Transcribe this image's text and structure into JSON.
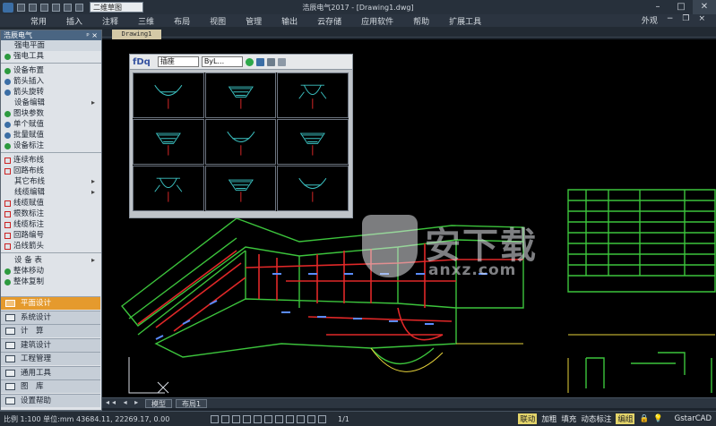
{
  "app": {
    "title": "浩辰电气2017 - [Drawing1.dwg]",
    "workspace": "二维草图"
  },
  "menu": [
    "常用",
    "插入",
    "注释",
    "三维",
    "布局",
    "视图",
    "管理",
    "输出",
    "云存储",
    "应用软件",
    "帮助",
    "扩展工具"
  ],
  "menu_right": "外观",
  "panel": {
    "title": "浩辰电气",
    "groups": [
      {
        "type": "sub",
        "label": "强电平面"
      },
      {
        "type": "item",
        "label": "强电工具",
        "icon": "dot-green"
      },
      {
        "type": "sep"
      },
      {
        "type": "item",
        "label": "设备布置",
        "icon": "dot-green"
      },
      {
        "type": "item",
        "label": "箭头插入",
        "icon": "arrow"
      },
      {
        "type": "item",
        "label": "箭头旋转",
        "icon": "arrow"
      },
      {
        "type": "item",
        "label": "设备编辑",
        "indent": true,
        "arrow": true
      },
      {
        "type": "item",
        "label": "图块参数",
        "icon": "dot-green"
      },
      {
        "type": "item",
        "label": "单个赋值",
        "icon": "arrow"
      },
      {
        "type": "item",
        "label": "批量赋值",
        "icon": "grid"
      },
      {
        "type": "item",
        "label": "设备标注",
        "icon": "dot-green"
      },
      {
        "type": "sep"
      },
      {
        "type": "item",
        "label": "连续布线",
        "icon": "line-red"
      },
      {
        "type": "item",
        "label": "回路布线",
        "icon": "line-red"
      },
      {
        "type": "item",
        "label": "其它布线",
        "indent": true,
        "arrow": true
      },
      {
        "type": "item",
        "label": "线缆编辑",
        "indent": true,
        "arrow": true
      },
      {
        "type": "item",
        "label": "线缆赋值",
        "icon": "line-red"
      },
      {
        "type": "item",
        "label": "根数标注",
        "icon": "line-red"
      },
      {
        "type": "item",
        "label": "线缆标注",
        "icon": "line-red"
      },
      {
        "type": "item",
        "label": "回路编号",
        "icon": "line-red"
      },
      {
        "type": "item",
        "label": "沿线箭头",
        "icon": "line-red"
      },
      {
        "type": "sep"
      },
      {
        "type": "item",
        "label": "设 备 表",
        "indent": true,
        "arrow": true
      },
      {
        "type": "item",
        "label": "整体移动",
        "icon": "dot-green"
      },
      {
        "type": "item",
        "label": "整体复制",
        "icon": "dot-green"
      }
    ],
    "accordion": [
      {
        "label": "平面设计",
        "active": true
      },
      {
        "label": "系统设计",
        "active": false
      },
      {
        "label": "计　算",
        "active": false
      },
      {
        "label": "建筑设计",
        "active": false
      },
      {
        "label": "工程管理",
        "active": false
      },
      {
        "label": "通用工具",
        "active": false
      },
      {
        "label": "图　库",
        "active": false
      },
      {
        "label": "设置帮助",
        "active": false
      }
    ]
  },
  "drawing_tab": "Drawing1",
  "float_window": {
    "logo": "fDq",
    "dropdown1": "插座",
    "dropdown2": "ByL..."
  },
  "layout_tabs": [
    "模型",
    "布局1"
  ],
  "status": {
    "scale": "比例 1:100",
    "unit": "单位:mm",
    "coords": "43684.11, 22269.17, 0.00",
    "zoom": "1/1",
    "modes": [
      "联动",
      "加粗",
      "填充",
      "动态标注",
      "编组"
    ],
    "brand": "GstarCAD"
  },
  "watermark": {
    "title": "安下载",
    "sub": "anxz.com"
  },
  "colors": {
    "accent": "#e59a2d",
    "panel": "#dfe3e8",
    "cad_bg": "#000000",
    "wire": "#e02828",
    "wall": "#3cc43c"
  }
}
